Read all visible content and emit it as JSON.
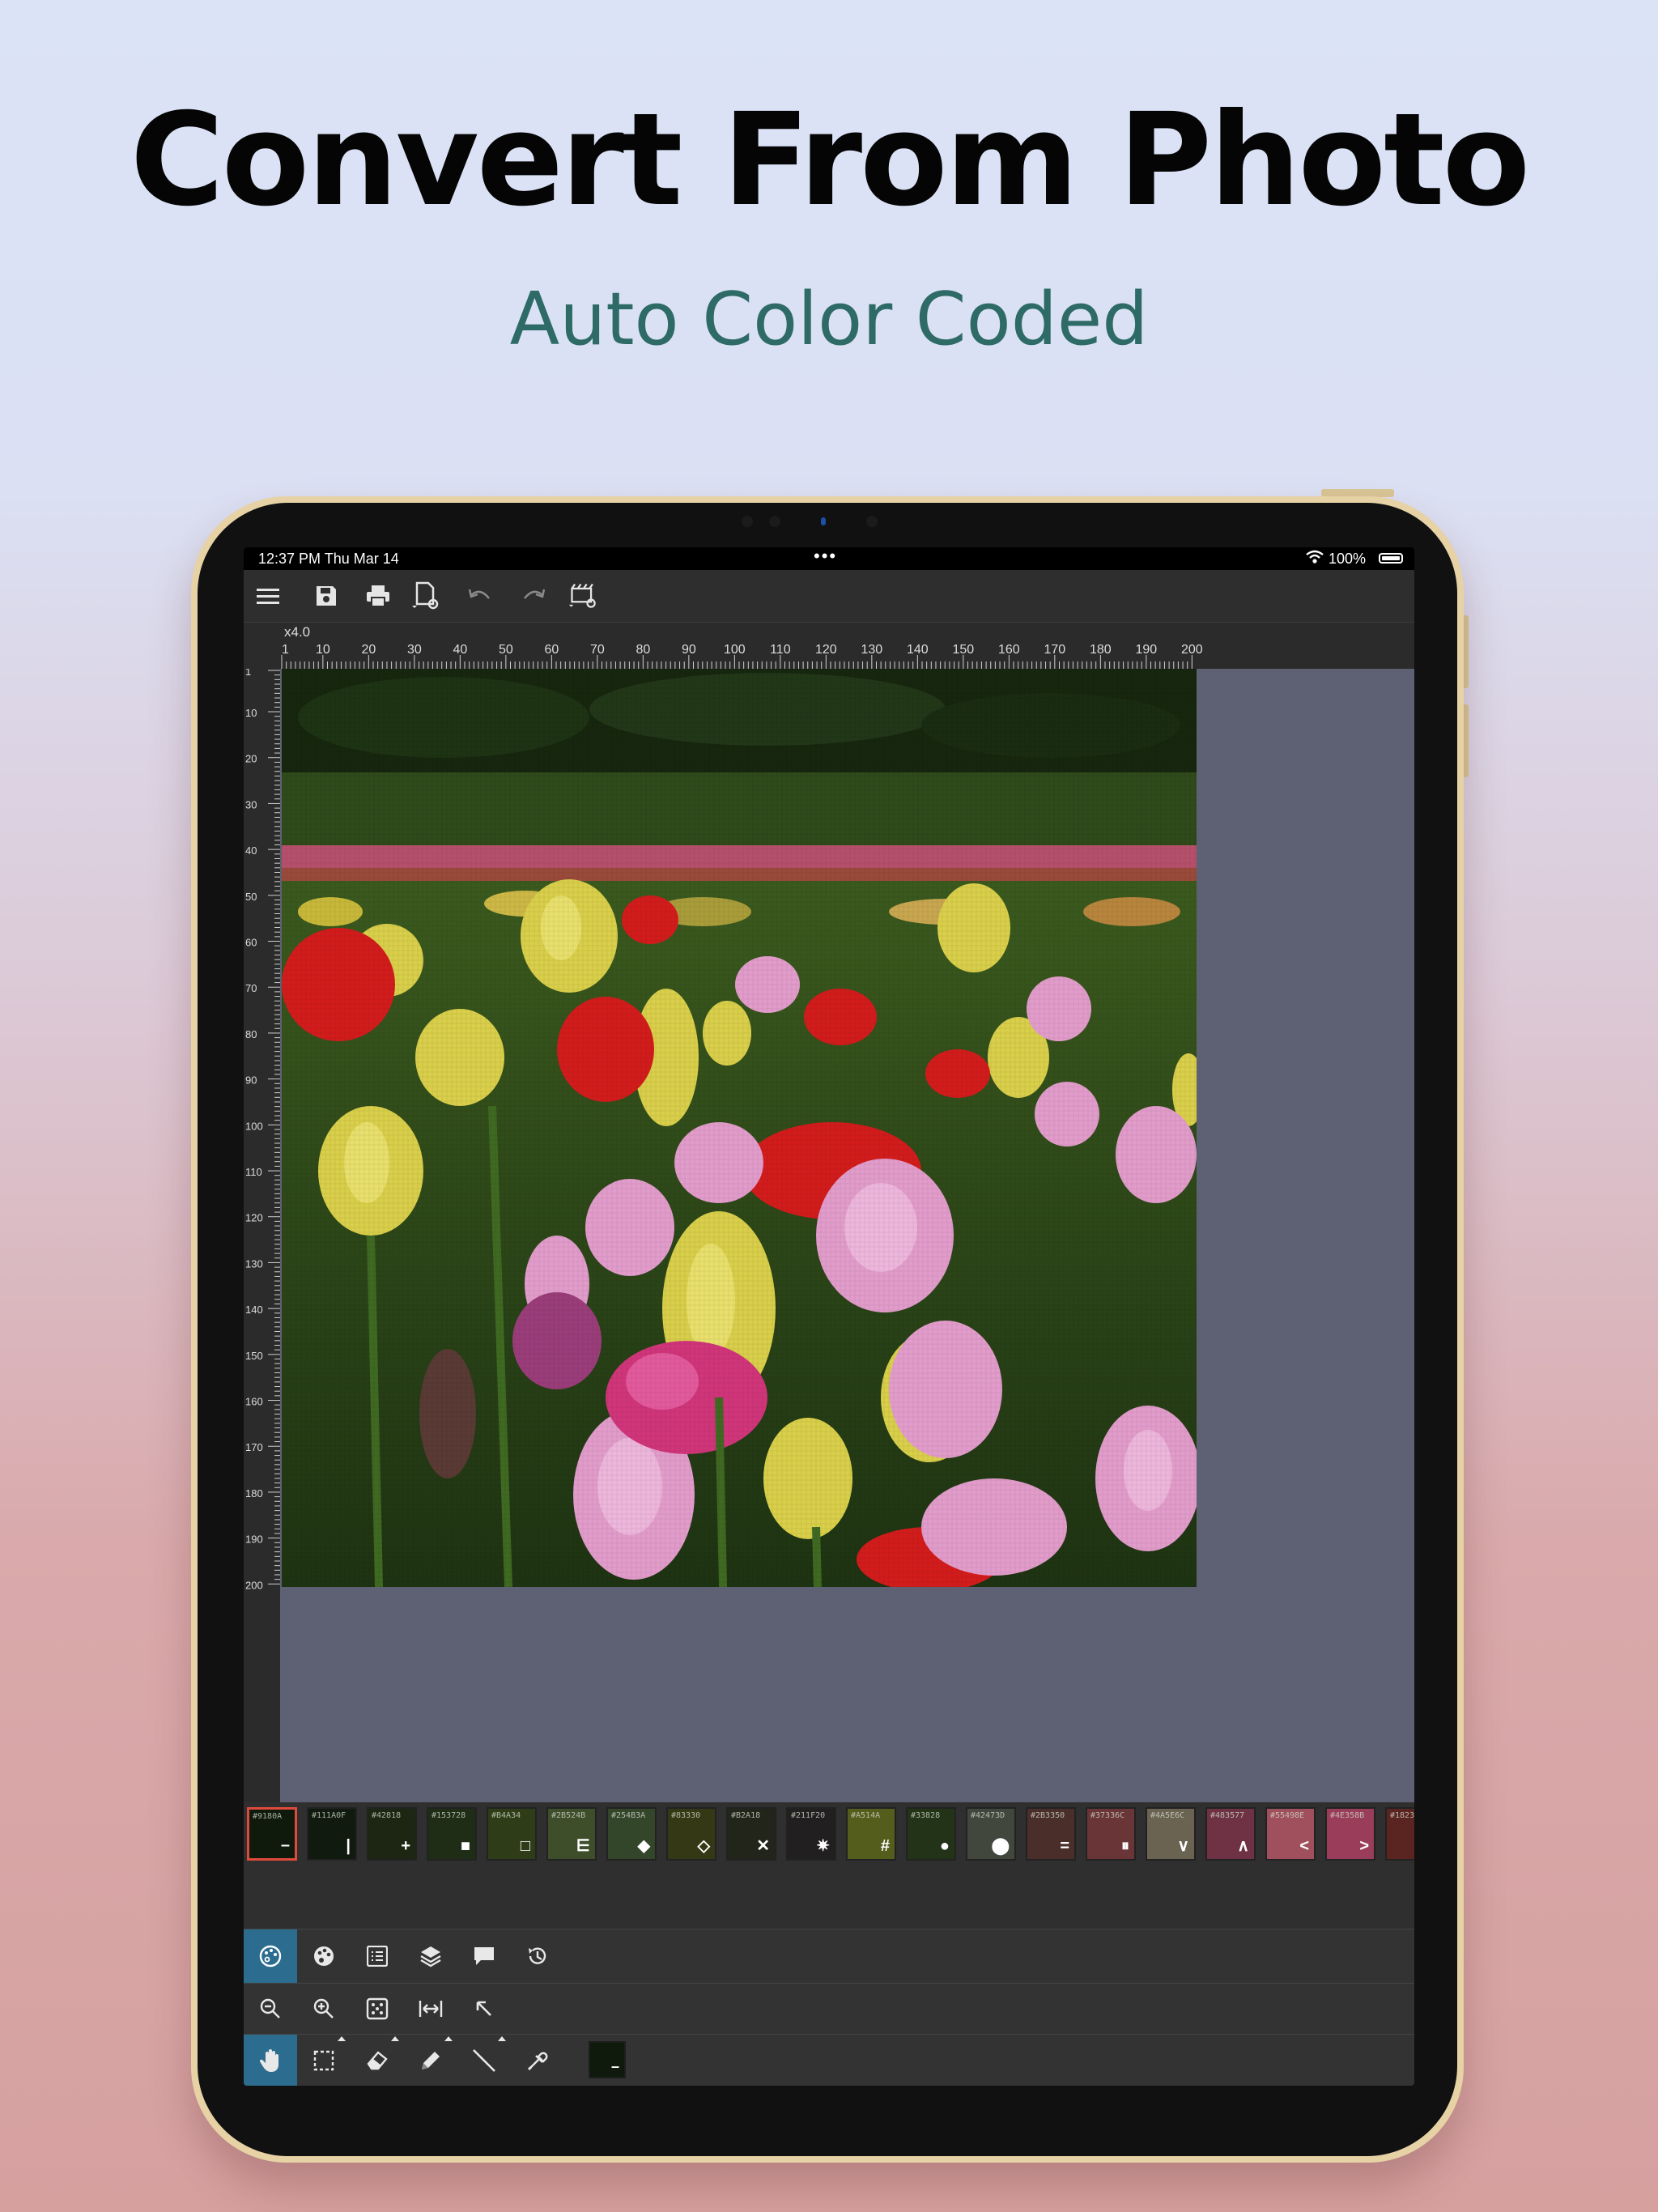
{
  "headline": "Convert From Photo",
  "subheadline": "Auto Color Coded",
  "status_bar": {
    "time": "12:37 PM  Thu Mar 14",
    "battery": "100%"
  },
  "canvas": {
    "zoom": "x4.0",
    "h_ticks": [
      "1",
      "10",
      "20",
      "30",
      "40",
      "50",
      "60",
      "70",
      "80",
      "90",
      "100",
      "110",
      "120",
      "130",
      "140",
      "150",
      "160",
      "170",
      "180",
      "190",
      "200"
    ],
    "v_ticks": [
      "1",
      "10",
      "20",
      "30",
      "40",
      "50",
      "60",
      "70",
      "80",
      "90",
      "100",
      "110",
      "120",
      "130",
      "140",
      "150",
      "160",
      "170",
      "180",
      "190",
      "200"
    ]
  },
  "palette": [
    {
      "hex": "#9180A",
      "sym": "–",
      "color": "#0f1a0c"
    },
    {
      "hex": "#111A0F",
      "sym": "|",
      "color": "#111a0f"
    },
    {
      "hex": "#42818",
      "sym": "+",
      "color": "#1c2612"
    },
    {
      "hex": "#153728",
      "sym": "■",
      "color": "#1f2c16"
    },
    {
      "hex": "#B4A34",
      "sym": "□",
      "color": "#2e3d17"
    },
    {
      "hex": "#2B524B",
      "sym": "⋿",
      "color": "#3e4d2a"
    },
    {
      "hex": "#254B3A",
      "sym": "◆",
      "color": "#34462a"
    },
    {
      "hex": "#83330",
      "sym": "◇",
      "color": "#343815"
    },
    {
      "hex": "#B2A18",
      "sym": "✕",
      "color": "#22251a"
    },
    {
      "hex": "#211F20",
      "sym": "✷",
      "color": "#211f20"
    },
    {
      "hex": "#A514A",
      "sym": "#",
      "color": "#545d1c"
    },
    {
      "hex": "#33828",
      "sym": "●",
      "color": "#233317"
    },
    {
      "hex": "#42473D",
      "sym": "⬤",
      "color": "#42473d"
    },
    {
      "hex": "#2B3350",
      "sym": "=",
      "color": "#4a2e2a"
    },
    {
      "hex": "#37336C",
      "sym": "⏸",
      "color": "#6a3537"
    },
    {
      "hex": "#4A5E6C",
      "sym": "∨",
      "color": "#6a6352"
    },
    {
      "hex": "#483577",
      "sym": "∧",
      "color": "#6e3244"
    },
    {
      "hex": "#55498E",
      "sym": "<",
      "color": "#a0505c"
    },
    {
      "hex": "#4E358B",
      "sym": ">",
      "color": "#9a3d5a"
    },
    {
      "hex": "#1823",
      "sym": "",
      "color": "#5a2420"
    }
  ],
  "active_color": {
    "sym": "–",
    "color": "#0f1a0c"
  }
}
